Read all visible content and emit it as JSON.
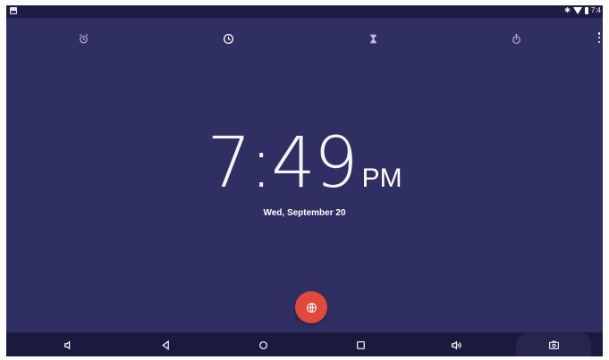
{
  "status_bar": {
    "time": "7:4"
  },
  "tabs": [
    {
      "name": "alarm",
      "icon": "alarm-icon"
    },
    {
      "name": "clock",
      "icon": "clock-icon"
    },
    {
      "name": "timer",
      "icon": "hourglass-icon"
    },
    {
      "name": "stopwatch",
      "icon": "stopwatch-icon"
    }
  ],
  "clock": {
    "time": "7:49",
    "ampm": "PM",
    "date": "Wed, September 20"
  },
  "fab": {
    "icon": "globe-icon"
  },
  "nav_bar": [
    {
      "name": "volume-down",
      "icon": "volume-down-icon"
    },
    {
      "name": "back",
      "icon": "back-icon"
    },
    {
      "name": "home",
      "icon": "home-icon"
    },
    {
      "name": "recents",
      "icon": "recents-icon"
    },
    {
      "name": "volume-up",
      "icon": "volume-up-icon"
    },
    {
      "name": "screenshot",
      "icon": "screenshot-icon"
    }
  ],
  "colors": {
    "background": "#2f2f63",
    "status_bar": "#1c1c45",
    "nav_bar": "#1a1a3e",
    "fab": "#e2493b"
  }
}
